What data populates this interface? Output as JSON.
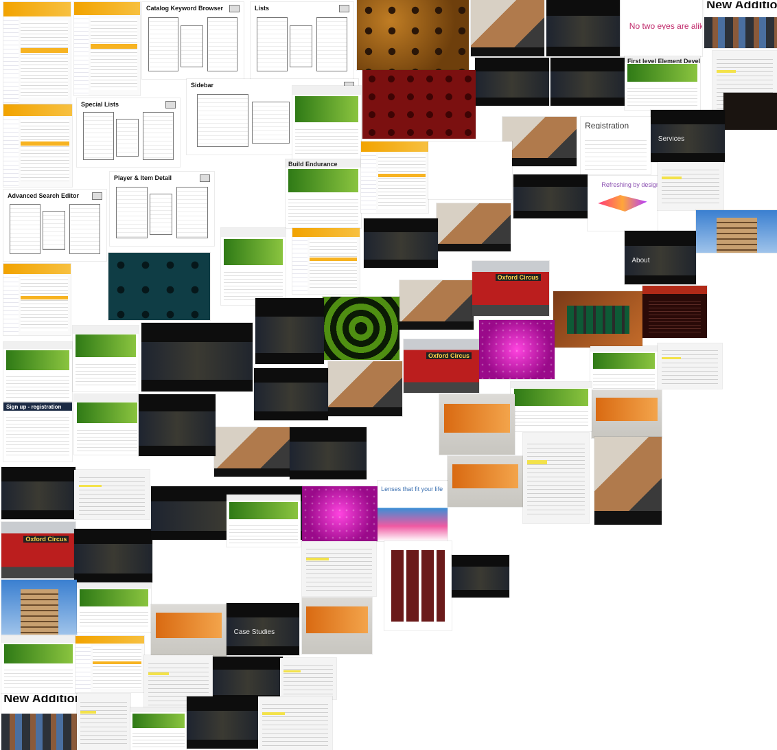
{
  "collage": {
    "title": "",
    "tiles": [
      {
        "theme": "doc",
        "name": "doc-tile"
      },
      {
        "theme": "doc",
        "name": "doc-tile"
      },
      {
        "theme": "wire",
        "name": "wireframe-tile",
        "caption": "Catalog Keyword Browser"
      },
      {
        "theme": "wire",
        "name": "wireframe-tile",
        "caption": "Lists"
      },
      {
        "theme": "teapot",
        "name": "pattern-tile"
      },
      {
        "theme": "photo-hands",
        "name": "photo-tile"
      },
      {
        "theme": "dark",
        "name": "dark-site-tile"
      },
      {
        "theme": "white-text",
        "name": "ad-tile",
        "caption": "No two eyes are alike"
      },
      {
        "theme": "additions",
        "name": "additions-tile",
        "caption": "New Additions"
      },
      {
        "theme": "dark",
        "name": "dark-site-tile"
      },
      {
        "theme": "dark",
        "name": "dark-site-tile"
      },
      {
        "theme": "hearts",
        "name": "pattern-tile"
      },
      {
        "theme": "lofi",
        "name": "list-tile"
      },
      {
        "theme": "site",
        "name": "site-tile",
        "caption": "First level Element Development"
      },
      {
        "theme": "wire",
        "name": "wireframe-tile",
        "caption": "Sidebar"
      },
      {
        "theme": "wire",
        "name": "wireframe-tile",
        "caption": "Special Lists"
      },
      {
        "theme": "site",
        "name": "site-tile"
      },
      {
        "theme": "brown",
        "name": "dark-site-tile"
      },
      {
        "theme": "dark",
        "name": "dark-site-tile",
        "caption": "Services"
      },
      {
        "theme": "reg",
        "name": "registration-tile",
        "caption": "Registration"
      },
      {
        "theme": "photo-hands",
        "name": "photo-tile"
      },
      {
        "theme": "doc",
        "name": "doc-tile"
      },
      {
        "theme": "site",
        "name": "site-tile",
        "caption": "Build Endurance"
      },
      {
        "theme": "doc",
        "name": "doc-tile"
      },
      {
        "theme": "white-text",
        "name": "portrait-tile"
      },
      {
        "theme": "dragonfly",
        "name": "dragonfly-tile",
        "caption": "Refreshing by design"
      },
      {
        "theme": "lofi",
        "name": "list-tile"
      },
      {
        "theme": "wire",
        "name": "wireframe-tile",
        "caption": "Player & Item Detail"
      },
      {
        "theme": "wire",
        "name": "wireframe-tile",
        "caption": "Advanced Search Editor"
      },
      {
        "theme": "keyhole",
        "name": "pattern-tile"
      },
      {
        "theme": "site",
        "name": "site-tile"
      },
      {
        "theme": "doc",
        "name": "doc-tile"
      },
      {
        "theme": "dark",
        "name": "dark-site-tile"
      },
      {
        "theme": "photo-hands",
        "name": "photo-tile"
      },
      {
        "theme": "dark",
        "name": "dark-site-tile"
      },
      {
        "theme": "dark",
        "name": "dark-site-tile",
        "caption": "About"
      },
      {
        "theme": "tower",
        "name": "photo-tile"
      },
      {
        "theme": "doc",
        "name": "doc-tile"
      },
      {
        "theme": "photo-hands",
        "name": "photo-tile"
      },
      {
        "theme": "bus",
        "name": "bus-tile",
        "caption": "Oxford Circus"
      },
      {
        "theme": "tools",
        "name": "photo-tile"
      },
      {
        "theme": "crimson",
        "name": "dark-site-tile"
      },
      {
        "theme": "green",
        "name": "pattern-tile"
      },
      {
        "theme": "dark",
        "name": "dark-site-tile"
      },
      {
        "theme": "site",
        "name": "site-tile"
      },
      {
        "theme": "magenta",
        "name": "pattern-tile"
      },
      {
        "theme": "bus",
        "name": "bus-tile",
        "caption": "Oxford Circus"
      },
      {
        "theme": "lofi",
        "name": "list-tile"
      },
      {
        "theme": "site",
        "name": "site-tile"
      },
      {
        "theme": "sign",
        "name": "signup-tile",
        "caption": "Sign up - registration"
      },
      {
        "theme": "site",
        "name": "site-tile"
      },
      {
        "theme": "dark",
        "name": "dark-site-tile"
      },
      {
        "theme": "photo-hands",
        "name": "photo-tile"
      },
      {
        "theme": "grey",
        "name": "grey-site-tile"
      },
      {
        "theme": "site",
        "name": "site-tile"
      },
      {
        "theme": "photo-hands",
        "name": "photo-tile"
      },
      {
        "theme": "dark",
        "name": "dark-site-tile"
      },
      {
        "theme": "site",
        "name": "site-tile"
      },
      {
        "theme": "grey",
        "name": "grey-site-tile"
      },
      {
        "theme": "lofi",
        "name": "list-tile"
      },
      {
        "theme": "dark",
        "name": "dark-site-tile"
      },
      {
        "theme": "dark",
        "name": "dark-site-tile"
      },
      {
        "theme": "dark",
        "name": "dark-site-tile"
      },
      {
        "theme": "magenta",
        "name": "pattern-tile"
      },
      {
        "theme": "city",
        "name": "city-tile",
        "caption": "Lenses that fit your life"
      },
      {
        "theme": "grey",
        "name": "grey-site-tile"
      },
      {
        "theme": "lofi",
        "name": "list-tile"
      },
      {
        "theme": "photo-hands",
        "name": "photo-tile"
      },
      {
        "theme": "bus",
        "name": "bus-tile",
        "caption": "Oxford Circus"
      },
      {
        "theme": "dark",
        "name": "dark-site-tile"
      },
      {
        "theme": "dark",
        "name": "dark-site-tile"
      },
      {
        "theme": "site",
        "name": "site-tile"
      },
      {
        "theme": "lofi",
        "name": "list-tile"
      },
      {
        "theme": "tiles",
        "name": "pattern-tile"
      },
      {
        "theme": "dark",
        "name": "dark-site-tile"
      },
      {
        "theme": "tower",
        "name": "photo-tile"
      },
      {
        "theme": "site",
        "name": "site-tile"
      },
      {
        "theme": "grey",
        "name": "grey-site-tile"
      },
      {
        "theme": "dark",
        "name": "dark-site-tile",
        "caption": "Case Studies"
      },
      {
        "theme": "grey",
        "name": "grey-site-tile"
      },
      {
        "theme": "site",
        "name": "site-tile"
      },
      {
        "theme": "doc",
        "name": "doc-tile"
      },
      {
        "theme": "lofi",
        "name": "list-tile"
      },
      {
        "theme": "dark",
        "name": "dark-site-tile"
      },
      {
        "theme": "lofi",
        "name": "list-tile"
      },
      {
        "theme": "additions",
        "name": "additions-tile",
        "caption": "New Additions"
      },
      {
        "theme": "lofi",
        "name": "list-tile"
      },
      {
        "theme": "site",
        "name": "site-tile"
      },
      {
        "theme": "dark",
        "name": "dark-site-tile"
      },
      {
        "theme": "lofi",
        "name": "list-tile"
      }
    ]
  }
}
